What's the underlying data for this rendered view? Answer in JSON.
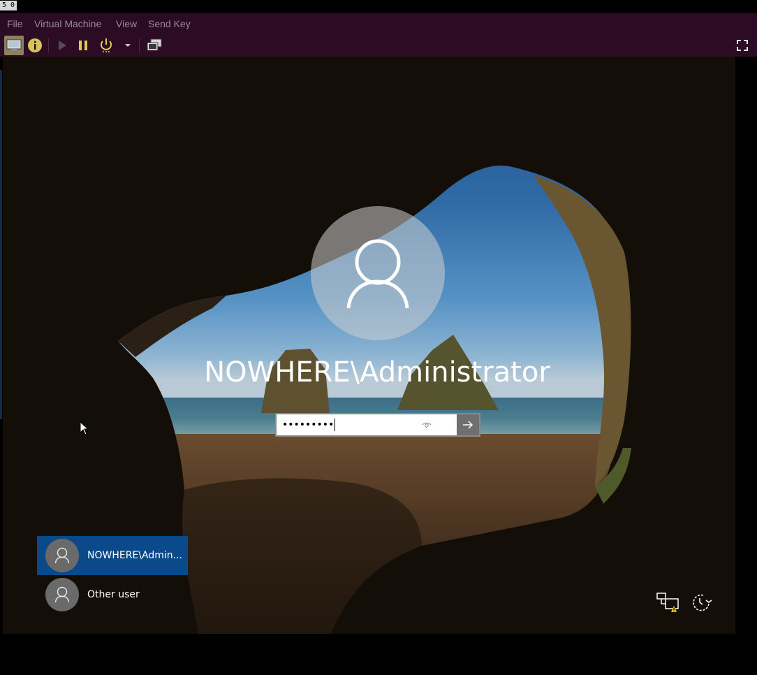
{
  "window": {
    "wm_tag": "5 0"
  },
  "menu": {
    "items": [
      {
        "label": "File"
      },
      {
        "label": "Virtual Machine"
      },
      {
        "label": "View"
      },
      {
        "label": "Send Key"
      }
    ]
  },
  "toolbar": {
    "icons": [
      "console-view-icon",
      "details-info-icon",
      "run-icon",
      "pause-icon",
      "power-icon",
      "power-menu-chevron-icon",
      "snapshots-icon",
      "fullscreen-icon"
    ]
  },
  "login": {
    "username": "NOWHERE\\Administrator",
    "password_masked": "•••••••••",
    "users": [
      {
        "label": "NOWHERE\\Admin...",
        "active": true
      },
      {
        "label": "Other user",
        "active": false
      }
    ]
  },
  "tray": {
    "icons": [
      "network-warning-icon",
      "ease-of-access-power-icon"
    ]
  }
}
